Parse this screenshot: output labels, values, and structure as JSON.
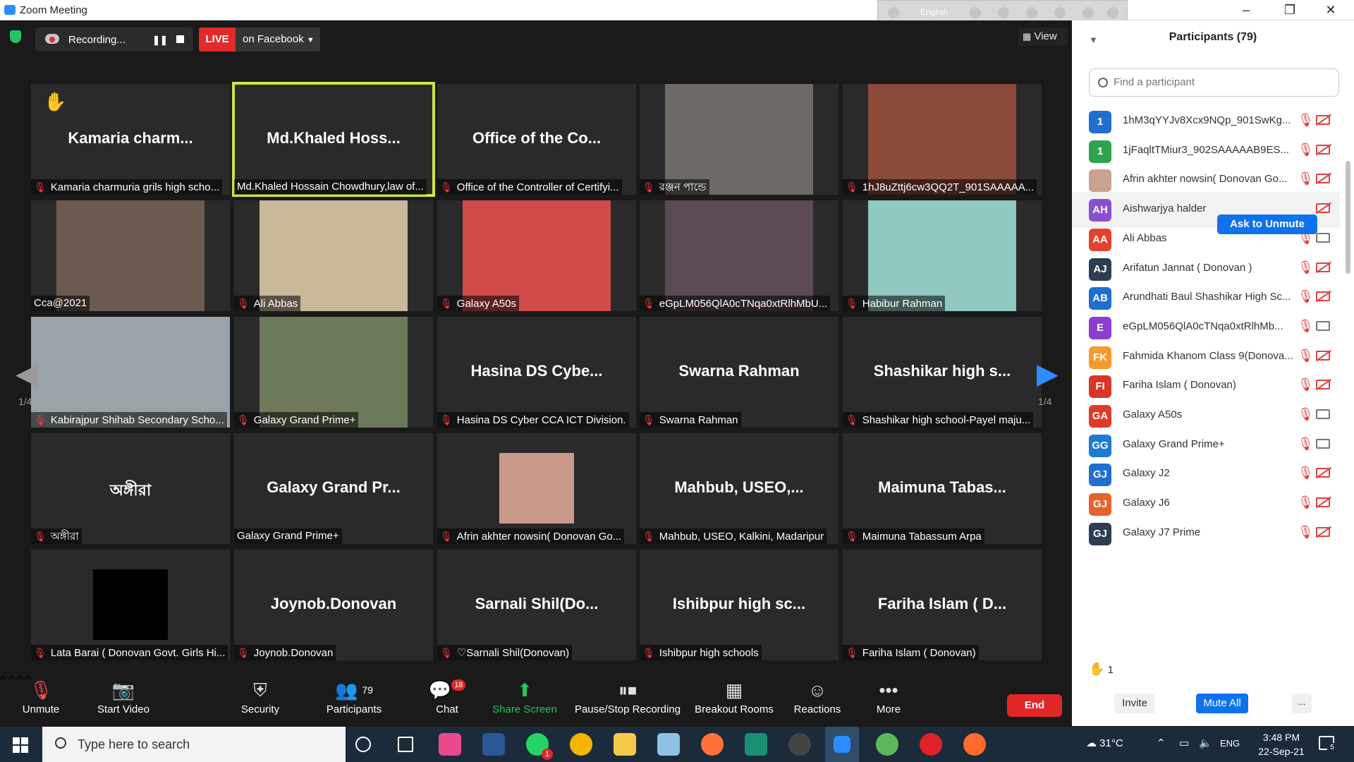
{
  "window": {
    "title": "Zoom Meeting"
  },
  "langbar": {
    "language": "English"
  },
  "topbar": {
    "recording_label": "Recording...",
    "live_label": "LIVE",
    "live_target": "on Facebook",
    "view_label": "View"
  },
  "gallery": {
    "page_indicator": "1/4",
    "tiles": [
      {
        "big": "Kamaria  charm...",
        "caption": "Kamaria charmuria grils high scho...",
        "muted": true,
        "hand": true
      },
      {
        "big": "Md.Khaled  Hoss...",
        "caption": "Md.Khaled Hossain Chowdhury,law of...",
        "muted": false,
        "active": true
      },
      {
        "big": "Office  of  the  Co...",
        "caption": "Office of the Controller of Certifyi...",
        "muted": true
      },
      {
        "big": "",
        "caption": "রঞ্জন পান্ডে",
        "muted": true,
        "video": "#6d6a66"
      },
      {
        "big": "",
        "caption": "1hJ8uZttj6cw3QQ2T_901SAAAAA...",
        "muted": true,
        "video": "#8b4a3a"
      },
      {
        "big": "",
        "caption": "Cca@2021",
        "muted": false,
        "video": "#6a5a4f"
      },
      {
        "big": "",
        "caption": "Ali Abbas",
        "muted": true,
        "video": "#c9b89a"
      },
      {
        "big": "",
        "caption": "Galaxy A50s",
        "muted": true,
        "video": "#d04a4a"
      },
      {
        "big": "",
        "caption": "eGpLM056QlA0cTNqa0xtRlhMbU...",
        "muted": true,
        "video": "#5b4a55"
      },
      {
        "big": "",
        "caption": "Habibur Rahman",
        "muted": true,
        "video": "#8fc9c0"
      },
      {
        "big": "",
        "caption": "Kabirajpur Shihab Secondary Scho...",
        "muted": true,
        "video": "#9aa4a8",
        "wide": true
      },
      {
        "big": "",
        "caption": "Galaxy Grand Prime+",
        "muted": true,
        "video": "#6d7a5a"
      },
      {
        "big": "Hasina  DS  Cybe...",
        "caption": "Hasina DS Cyber CCA ICT Division.",
        "muted": true
      },
      {
        "big": "Swarna Rahman",
        "caption": "Swarna Rahman",
        "muted": true
      },
      {
        "big": "Shashikar  high  s...",
        "caption": "Shashikar high school-Payel maju...",
        "muted": true
      },
      {
        "big": "অঙ্গীরা",
        "caption": "অঙ্গীরা",
        "muted": true
      },
      {
        "big": "Galaxy Grand Pr...",
        "caption": "Galaxy Grand Prime+",
        "muted": false
      },
      {
        "big": "",
        "caption": "Afrin akhter nowsin( Donovan Go...",
        "muted": true,
        "video": "#c99a8a",
        "small": true
      },
      {
        "big": "Mahbub,  USEO,...",
        "caption": "Mahbub, USEO, Kalkini, Madaripur",
        "muted": true
      },
      {
        "big": "Maimuna  Tabas...",
        "caption": "Maimuna Tabassum Arpa",
        "muted": true
      },
      {
        "big": "",
        "caption": "Lata Barai ( Donovan Govt. Girls Hi...",
        "muted": true,
        "video": "#000000",
        "small": true
      },
      {
        "big": "Joynob.Donovan",
        "caption": "Joynob.Donovan",
        "muted": true
      },
      {
        "big": "Sarnali  Shil(Do...",
        "caption": "♡Sarnali Shil(Donovan)",
        "muted": true
      },
      {
        "big": "Ishibpur  high  sc...",
        "caption": "Ishibpur high schools",
        "muted": true
      },
      {
        "big": "Fariha  Islam  (  D...",
        "caption": "Fariha Islam ( Donovan)",
        "muted": true
      }
    ]
  },
  "toolbar": {
    "unmute": "Unmute",
    "start_video": "Start Video",
    "security": "Security",
    "participants": "Participants",
    "participants_count": "79",
    "chat": "Chat",
    "chat_badge": "18",
    "share_screen": "Share Screen",
    "pause_stop_recording": "Pause/Stop Recording",
    "breakout_rooms": "Breakout Rooms",
    "reactions": "Reactions",
    "more": "More",
    "end": "End"
  },
  "panel": {
    "title": "Participants (79)",
    "search_placeholder": "Find a participant",
    "ask_to_unmute": "Ask to Unmute",
    "participants": [
      {
        "initials": "1",
        "color": "#1f6fd1",
        "name": "1hM3qYYJv8Xcx9NQp_901SwKg...",
        "cam": "off"
      },
      {
        "initials": "1",
        "color": "#2ea44f",
        "name": "1jFaqltTMiur3_902SAAAAAB9ES...",
        "cam": "off"
      },
      {
        "initials": "",
        "color": "#c9a38f",
        "name": "Afrin akhter nowsin( Donovan Go...",
        "cam": "off"
      },
      {
        "initials": "AH",
        "color": "#8a4fd1",
        "name": "Aishwarjya halder",
        "cam": "off"
      },
      {
        "initials": "AA",
        "color": "#e5412d",
        "name": "Ali Abbas",
        "cam": "on"
      },
      {
        "initials": "AJ",
        "color": "#2c3e50",
        "name": "Arifatun Jannat ( Donovan )",
        "cam": "off"
      },
      {
        "initials": "AB",
        "color": "#1f6fd1",
        "name": "Arundhati Baul Shashikar High Sc...",
        "cam": "off"
      },
      {
        "initials": "E",
        "color": "#8a3fd1",
        "name": "eGpLM056QlA0cTNqa0xtRlhMb...",
        "cam": "on"
      },
      {
        "initials": "FK",
        "color": "#f59b2b",
        "name": "Fahmida Khanom Class 9(Donova...",
        "cam": "off"
      },
      {
        "initials": "FI",
        "color": "#d9352b",
        "name": "Fariha Islam ( Donovan)",
        "cam": "off"
      },
      {
        "initials": "GA",
        "color": "#e03a2b",
        "name": "Galaxy A50s",
        "cam": "on"
      },
      {
        "initials": "GG",
        "color": "#1f7ad1",
        "name": "Galaxy Grand Prime+",
        "cam": "on"
      },
      {
        "initials": "GJ",
        "color": "#1f6fd1",
        "name": "Galaxy J2",
        "cam": "off"
      },
      {
        "initials": "GJ",
        "color": "#e8632b",
        "name": "Galaxy J6",
        "cam": "off"
      },
      {
        "initials": "GJ",
        "color": "#2c3e50",
        "name": "Galaxy J7 Prime",
        "cam": "off"
      }
    ],
    "hand_count": "1",
    "invite": "Invite",
    "mute_all": "Mute All",
    "more": "..."
  },
  "taskbar": {
    "search_placeholder": "Type here to search",
    "weather": "31°C",
    "language": "ENG",
    "time": "3:48 PM",
    "date": "22-Sep-21",
    "notification_count": "5",
    "whatsapp_badge": "1"
  }
}
